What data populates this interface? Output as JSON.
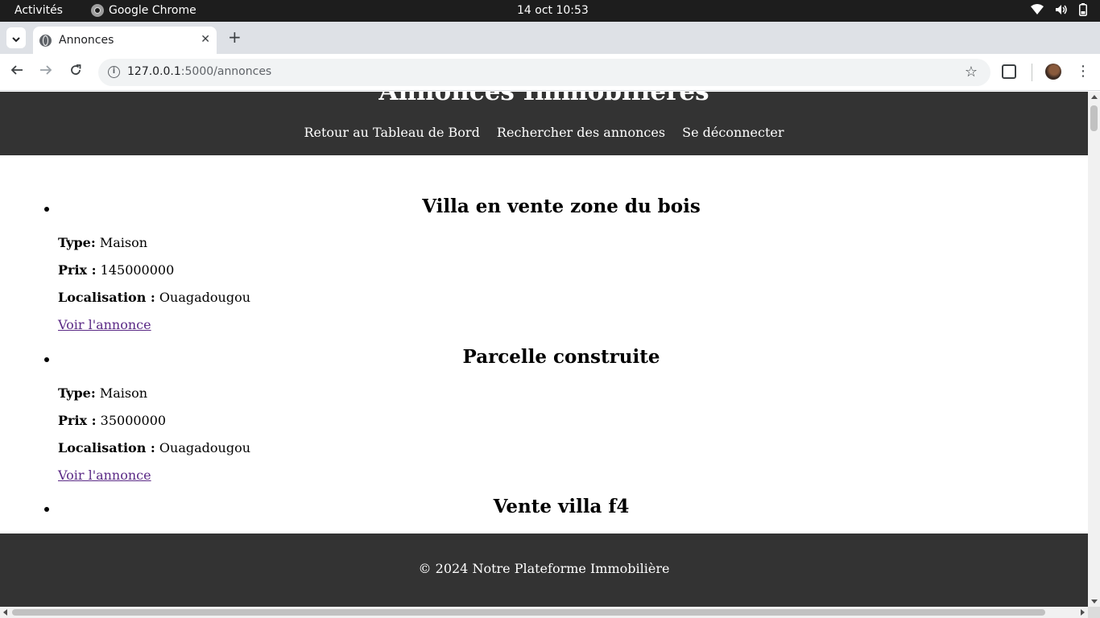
{
  "system_bar": {
    "activities": "Activités",
    "app_name": "Google Chrome",
    "clock": "14 oct  10:53",
    "tray_icons": [
      "wifi-icon",
      "volume-icon",
      "battery-icon"
    ]
  },
  "browser": {
    "tab_title": "Annonces",
    "url_host": "127.0.0.1",
    "url_rest": ":5000/annonces"
  },
  "site": {
    "title": "Annonces Immobilières",
    "nav": [
      "Retour au Tableau de Bord",
      "Rechercher des annonces",
      "Se déconnecter"
    ],
    "footer": "© 2024 Notre Plateforme Immobilière"
  },
  "listings": [
    {
      "title": "Villa en vente zone du bois",
      "type_label": "Type:",
      "type": "Maison",
      "price_label": "Prix :",
      "price": "145000000",
      "location_label": "Localisation :",
      "location": "Ouagadougou",
      "link": "Voir l'annonce"
    },
    {
      "title": "Parcelle construite",
      "type_label": "Type:",
      "type": "Maison",
      "price_label": "Prix :",
      "price": "35000000",
      "location_label": "Localisation :",
      "location": "Ouagadougou",
      "link": "Voir l'annonce"
    },
    {
      "title": "Vente villa f4"
    }
  ],
  "colors": {
    "header_bg": "#333333",
    "visited_link": "#5b2a86"
  }
}
